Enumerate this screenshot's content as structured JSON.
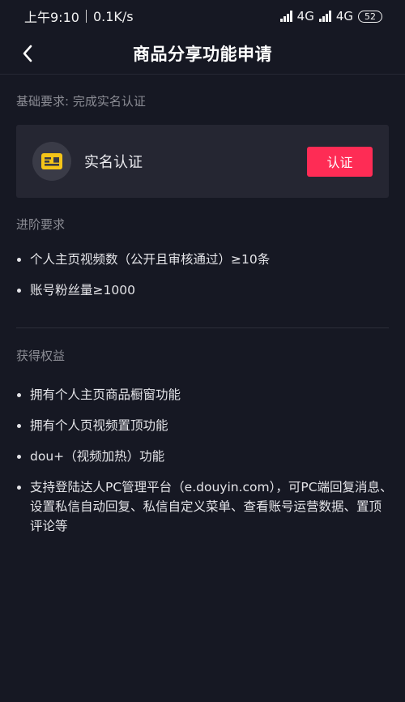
{
  "status_bar": {
    "time": "上午9:10",
    "speed": "0.1K/s",
    "network_1": "4G",
    "network_2": "4G",
    "battery": "52"
  },
  "header": {
    "title": "商品分享功能申请"
  },
  "basic": {
    "label": "基础要求: 完成实名认证",
    "card_label": "实名认证",
    "button_label": "认证"
  },
  "advanced": {
    "label": "进阶要求",
    "items": [
      "个人主页视频数（公开且审核通过）≥10条",
      "账号粉丝量≥1000"
    ]
  },
  "benefits": {
    "label": "获得权益",
    "items": [
      "拥有个人主页商品橱窗功能",
      "拥有个人页视频置顶功能",
      "dou+（视频加热）功能",
      "支持登陆达人PC管理平台（e.douyin.com），可PC端回复消息、设置私信自动回复、私信自定义菜单、查看账号运营数据、置顶评论等"
    ]
  },
  "colors": {
    "background": "#161823",
    "card": "#252632",
    "accent": "#fe2c55",
    "id_icon": "#f5c518"
  },
  "icons": {
    "back": "chevron-left-icon",
    "id_card": "id-card-icon"
  }
}
